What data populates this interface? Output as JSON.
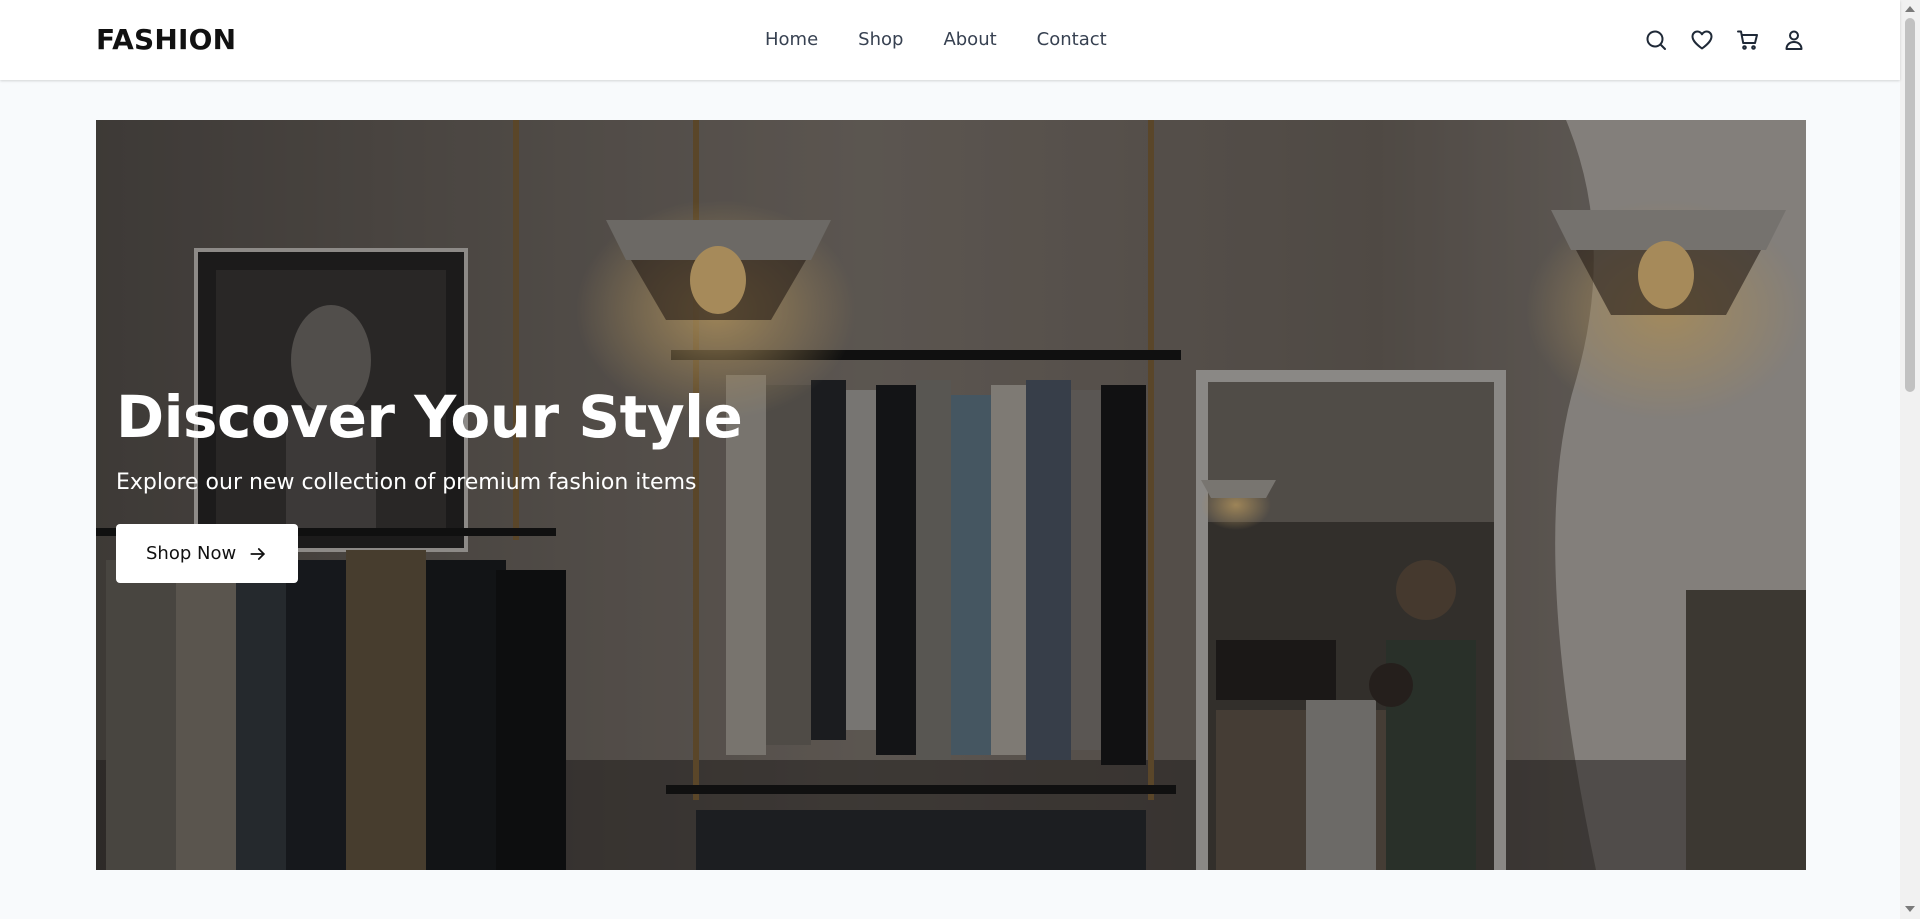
{
  "header": {
    "logo": "FASHION",
    "nav": [
      {
        "label": "Home"
      },
      {
        "label": "Shop"
      },
      {
        "label": "About"
      },
      {
        "label": "Contact"
      }
    ],
    "icons": [
      "search-icon",
      "heart-icon",
      "cart-icon",
      "user-icon"
    ]
  },
  "hero": {
    "title": "Discover Your Style",
    "subtitle": "Explore our new collection of premium fashion items",
    "cta_label": "Shop Now",
    "cta_icon": "arrow-right-icon",
    "image": "clothing-store-interior-photo"
  },
  "colors": {
    "page_bg": "#f8fafc",
    "header_bg": "#ffffff",
    "nav_text": "#374151",
    "logo_text": "#111111",
    "hero_text": "#ffffff",
    "cta_bg": "#ffffff"
  }
}
